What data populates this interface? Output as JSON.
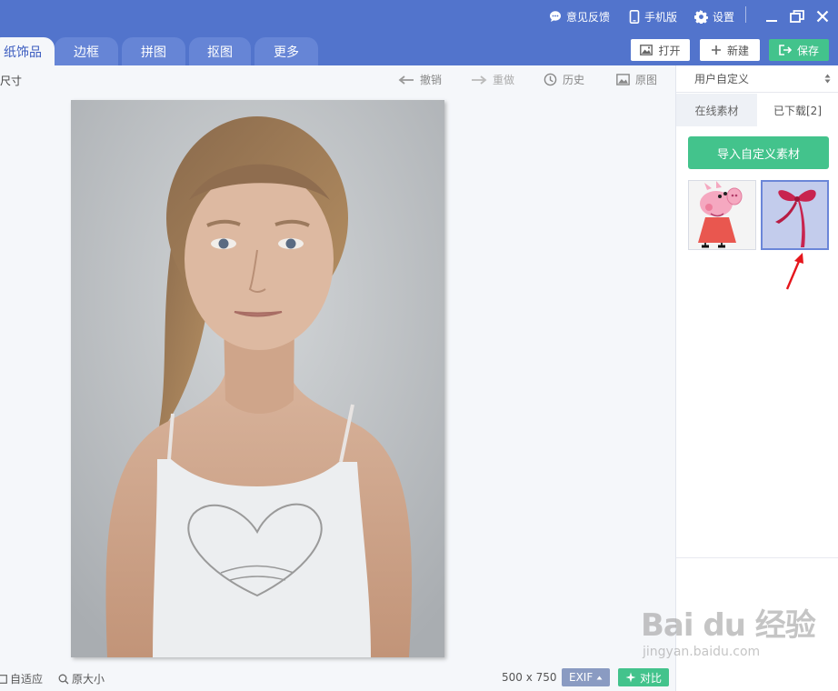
{
  "titlebar": {
    "feedback": "意见反馈",
    "mobile": "手机版",
    "settings": "设置",
    "color": "#5274cc"
  },
  "tabs": [
    {
      "label": "纸饰品",
      "active": true
    },
    {
      "label": "边框"
    },
    {
      "label": "拼图"
    },
    {
      "label": "抠图"
    },
    {
      "label": "更多"
    }
  ],
  "header_buttons": {
    "open": "打开",
    "new": "新建",
    "save": "保存",
    "save_color": "#43c38c"
  },
  "toolbar": {
    "crumb": "尺寸",
    "undo": "撤销",
    "redo": "重做",
    "history": "历史",
    "original": "原图"
  },
  "canvas": {
    "fit": "自适应",
    "actual_size": "原大小",
    "dimensions": "500 x 750",
    "exif": "EXIF",
    "compare": "对比"
  },
  "panel": {
    "category_select": "用户自定义",
    "tab_online": "在线素材",
    "tab_downloaded": "已下载[2]",
    "import_button": "导入自定义素材",
    "thumbnails": [
      "peppa-pig-sticker",
      "red-bow-sticker"
    ]
  },
  "watermark": {
    "logo": "Bai du 经验",
    "url": "jingyan.baidu.com"
  }
}
